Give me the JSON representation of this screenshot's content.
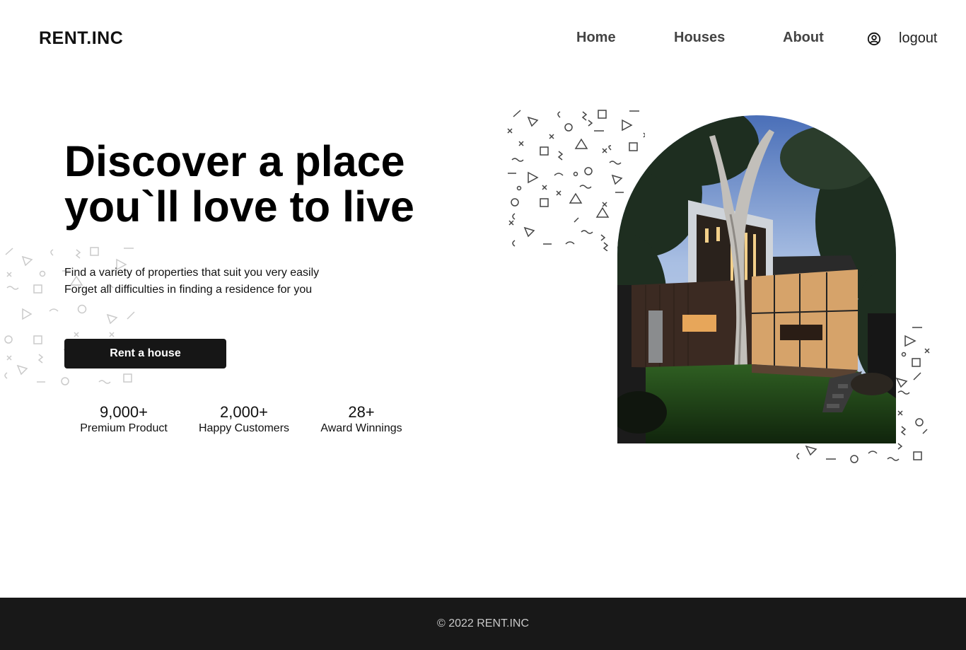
{
  "brand": "RENT.INC",
  "nav": {
    "home": "Home",
    "houses": "Houses",
    "about": "About",
    "logout": "logout"
  },
  "icons": {
    "account": "user-circle-icon"
  },
  "hero": {
    "title_line1": "Discover a place",
    "title_line2": "you`ll love to live",
    "sub_line1": "Find a variety of properties that suit you very easily",
    "sub_line2": "Forget all difficulties in finding a residence for you",
    "cta": "Rent a house"
  },
  "stats": [
    {
      "value": "9,000+",
      "label": "Premium Product"
    },
    {
      "value": "2,000+",
      "label": "Happy Customers"
    },
    {
      "value": "28+",
      "label": "Award Winnings"
    }
  ],
  "footer": {
    "copyright": "© 2022 RENT.INC"
  },
  "colors": {
    "primary": "#161616",
    "footer_bg": "#181818",
    "nav_text": "#444444"
  }
}
